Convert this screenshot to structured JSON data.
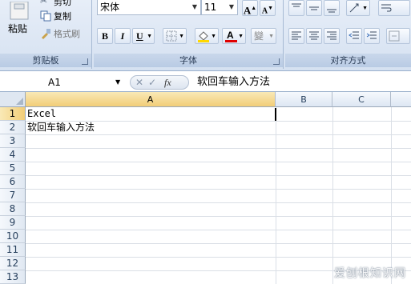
{
  "ribbon": {
    "clipboard": {
      "label": "剪贴板",
      "paste_label": "粘贴",
      "cut_label": "剪切",
      "copy_label": "复制",
      "format_painter_label": "格式刷"
    },
    "font": {
      "label": "字体",
      "font_name": "宋体",
      "font_size": "11",
      "bold": "B",
      "italic": "I",
      "underline": "U",
      "grow_font": "A",
      "shrink_font": "A",
      "font_color_glyph": "A",
      "phonetic_glyph": "變"
    },
    "alignment": {
      "label": "对齐方式"
    }
  },
  "formula_bar": {
    "name_box": "A1",
    "cancel_glyph": "✕",
    "enter_glyph": "✓",
    "fx_label": "fx",
    "content": "软回车输入方法"
  },
  "sheet": {
    "columns": [
      "A",
      "B",
      "C"
    ],
    "rows": [
      "1",
      "2",
      "3",
      "4",
      "5",
      "6",
      "7",
      "8",
      "9",
      "10",
      "11",
      "12",
      "13"
    ],
    "cells": {
      "A1": "Excel",
      "A2": "软回车输入方法"
    }
  },
  "watermark": "爱刨根知识网",
  "colors": {
    "ribbon_bg": "#dbe5f1",
    "selected_header": "#f2cd77",
    "font_color_red": "#e00000"
  }
}
